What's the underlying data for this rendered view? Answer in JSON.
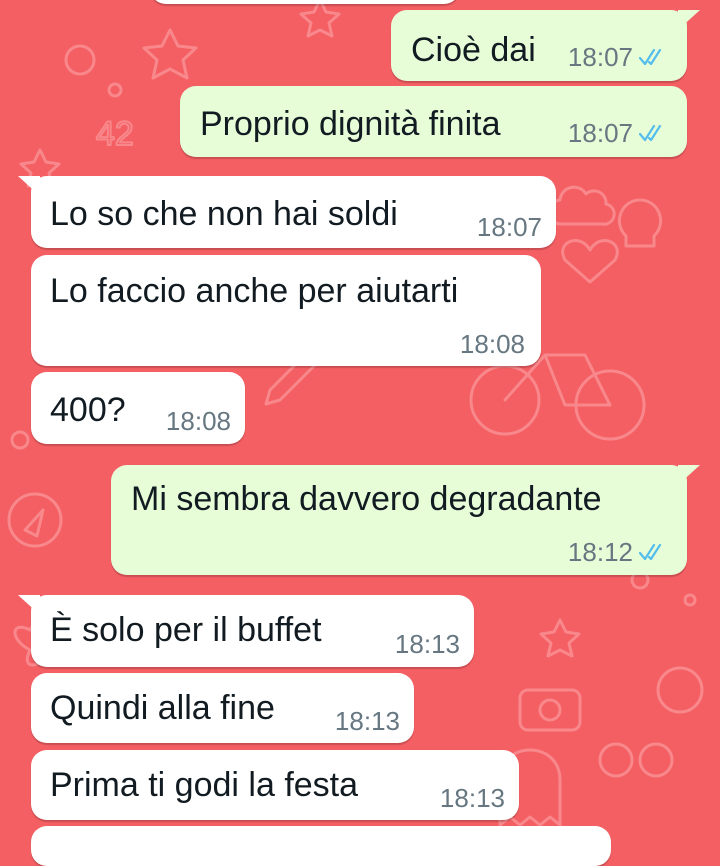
{
  "chat": {
    "messages": [
      {
        "dir": "out",
        "text": "Cioè dai",
        "time": "18:07",
        "status_icon": "double-check-read-icon"
      },
      {
        "dir": "out",
        "text": "Proprio dignità finita",
        "time": "18:07",
        "status_icon": "double-check-read-icon"
      },
      {
        "dir": "in",
        "text": "Lo so che non hai soldi",
        "time": "18:07"
      },
      {
        "dir": "in",
        "text": "Lo faccio anche per aiutarti",
        "time": "18:08"
      },
      {
        "dir": "in",
        "text": "400?",
        "time": "18:08"
      },
      {
        "dir": "out",
        "text": "Mi sembra davvero degradante",
        "time": "18:12",
        "status_icon": "double-check-read-icon"
      },
      {
        "dir": "in",
        "text": "È solo per il buffet",
        "time": "18:13"
      },
      {
        "dir": "in",
        "text": "Quindi alla fine",
        "time": "18:13"
      },
      {
        "dir": "in",
        "text": "Prima ti godi la festa",
        "time": "18:13"
      }
    ]
  },
  "colors": {
    "wallpaper": "#f45f63",
    "outgoing_bubble": "#e7fdd8",
    "incoming_bubble": "#ffffff",
    "read_tick": "#53bdeb",
    "timestamp": "#667781"
  }
}
